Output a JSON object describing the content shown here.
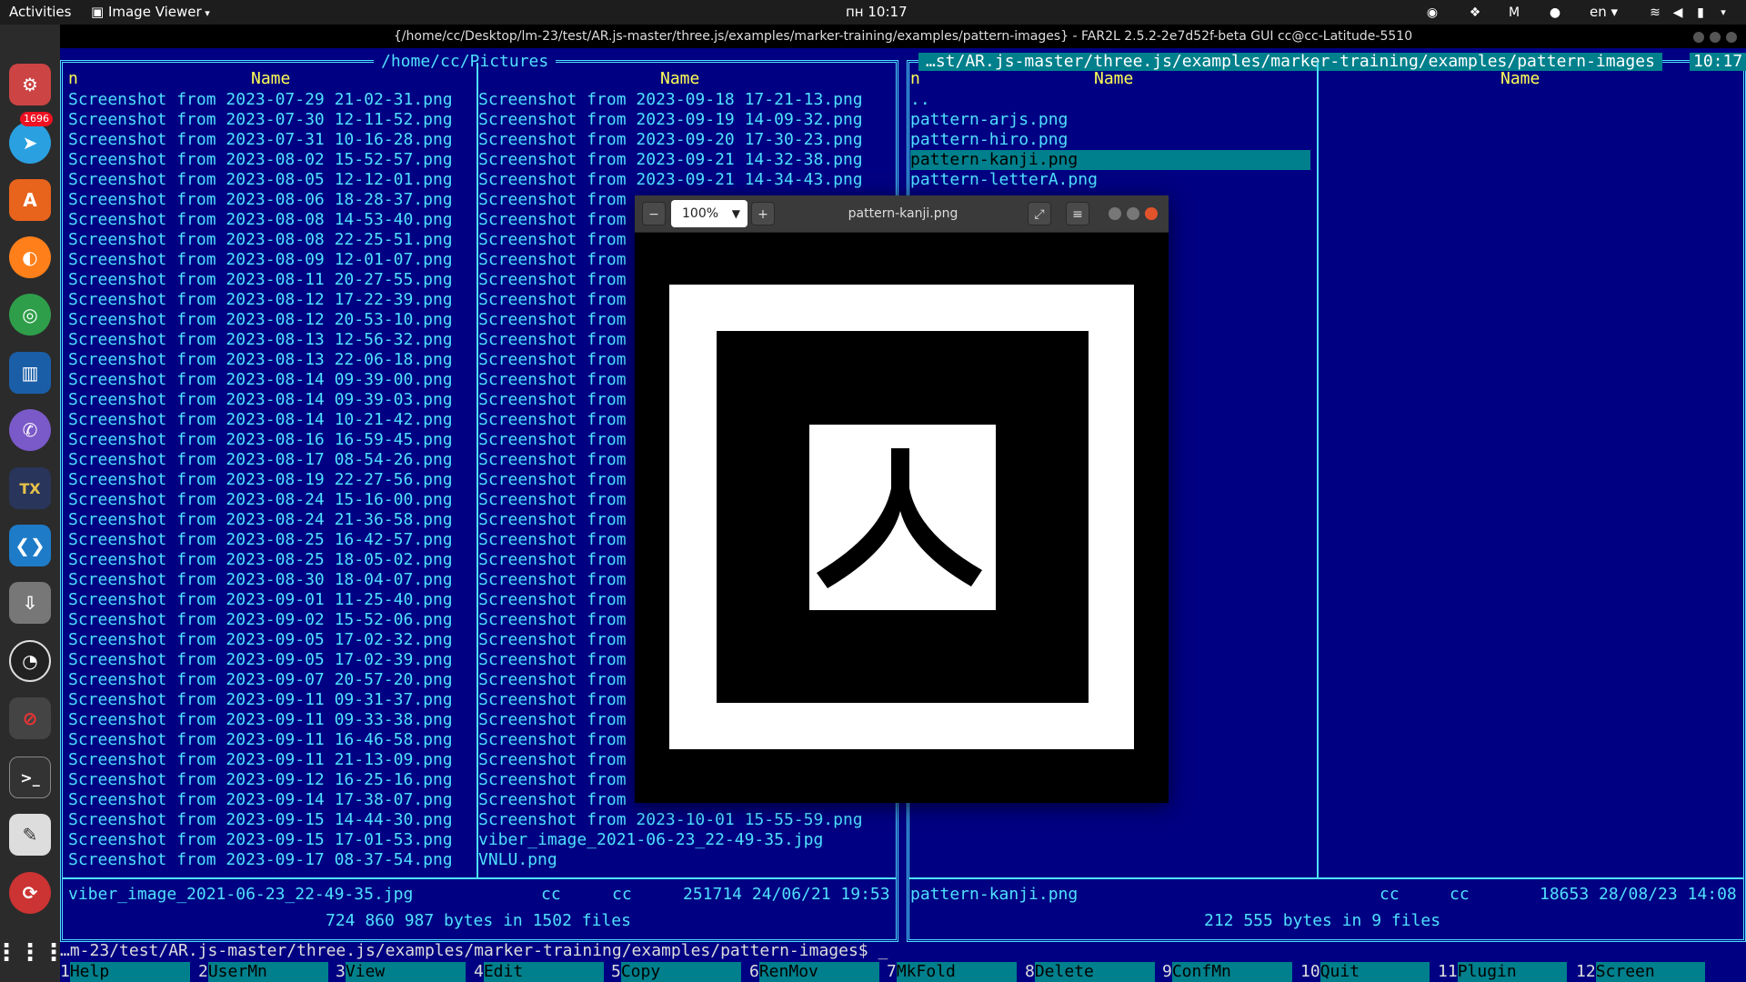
{
  "topbar": {
    "activities": "Activities",
    "app_menu": "Image Viewer",
    "clock": "пн 10:17",
    "lang": "en"
  },
  "dock": {
    "telegram_badge": "1696",
    "items": [
      "settings-icon",
      "telegram-icon",
      "software-center-icon",
      "firefox-icon",
      "chrome-icon",
      "file-manager-icon",
      "viber-icon",
      "texmaker-icon",
      "vscode-icon",
      "installer-icon",
      "obs-icon",
      "blocker-icon",
      "terminal-icon",
      "text-editor-icon",
      "remmina-icon",
      "app-grid-icon"
    ]
  },
  "terminal": {
    "window_title": "{/home/cc/Desktop/lm-23/test/AR.js-master/three.js/examples/marker-training/examples/pattern-images} - FAR2L 2.5.2-2e7d52f-beta GUI cc@cc-Latitude-5510",
    "left_panel": {
      "path": "/home/cc/Pictures",
      "col1_header_n": "n",
      "col1_header": "Name",
      "col2_header": "Name",
      "col1": [
        "Screenshot from 2023-07-29 21-02-31.png",
        "Screenshot from 2023-07-30 12-11-52.png",
        "Screenshot from 2023-07-31 10-16-28.png",
        "Screenshot from 2023-08-02 15-52-57.png",
        "Screenshot from 2023-08-05 12-12-01.png",
        "Screenshot from 2023-08-06 18-28-37.png",
        "Screenshot from 2023-08-08 14-53-40.png",
        "Screenshot from 2023-08-08 22-25-51.png",
        "Screenshot from 2023-08-09 12-01-07.png",
        "Screenshot from 2023-08-11 20-27-55.png",
        "Screenshot from 2023-08-12 17-22-39.png",
        "Screenshot from 2023-08-12 20-53-10.png",
        "Screenshot from 2023-08-13 12-56-32.png",
        "Screenshot from 2023-08-13 22-06-18.png",
        "Screenshot from 2023-08-14 09-39-00.png",
        "Screenshot from 2023-08-14 09-39-03.png",
        "Screenshot from 2023-08-14 10-21-42.png",
        "Screenshot from 2023-08-16 16-59-45.png",
        "Screenshot from 2023-08-17 08-54-26.png",
        "Screenshot from 2023-08-19 22-27-56.png",
        "Screenshot from 2023-08-24 15-16-00.png",
        "Screenshot from 2023-08-24 21-36-58.png",
        "Screenshot from 2023-08-25 16-42-57.png",
        "Screenshot from 2023-08-25 18-05-02.png",
        "Screenshot from 2023-08-30 18-04-07.png",
        "Screenshot from 2023-09-01 11-25-40.png",
        "Screenshot from 2023-09-02 15-52-06.png",
        "Screenshot from 2023-09-05 17-02-32.png",
        "Screenshot from 2023-09-05 17-02-39.png",
        "Screenshot from 2023-09-07 20-57-20.png",
        "Screenshot from 2023-09-11 09-31-37.png",
        "Screenshot from 2023-09-11 09-33-38.png",
        "Screenshot from 2023-09-11 16-46-58.png",
        "Screenshot from 2023-09-11 21-13-09.png",
        "Screenshot from 2023-09-12 16-25-16.png",
        "Screenshot from 2023-09-14 17-38-07.png",
        "Screenshot from 2023-09-15 14-44-30.png",
        "Screenshot from 2023-09-15 17-01-53.png",
        "Screenshot from 2023-09-17 08-37-54.png"
      ],
      "col2": [
        "Screenshot from 2023-09-18 17-21-13.png",
        "Screenshot from 2023-09-19 14-09-32.png",
        "Screenshot from 2023-09-20 17-30-23.png",
        "Screenshot from 2023-09-21 14-32-38.png",
        "Screenshot from 2023-09-21 14-34-43.png",
        "Screenshot from",
        "Screenshot from",
        "Screenshot from",
        "Screenshot from",
        "Screenshot from",
        "Screenshot from",
        "Screenshot from",
        "Screenshot from",
        "Screenshot from",
        "Screenshot from",
        "Screenshot from",
        "Screenshot from",
        "Screenshot from",
        "Screenshot from",
        "Screenshot from",
        "Screenshot from",
        "Screenshot from",
        "Screenshot from",
        "Screenshot from",
        "Screenshot from",
        "Screenshot from",
        "Screenshot from",
        "Screenshot from",
        "Screenshot from",
        "Screenshot from",
        "Screenshot from",
        "Screenshot from",
        "Screenshot from",
        "Screenshot from",
        "Screenshot from",
        "Screenshot from",
        "Screenshot from 2023-10-01 15-55-59.png",
        "viber_image_2021-06-23_22-49-35.jpg",
        "VNLU.png"
      ],
      "footer_name": "viber_image_2021-06-23_22-49-35.jpg",
      "footer_owner": "cc",
      "footer_group": "cc",
      "footer_size_date": "251714 24/06/21 19:53",
      "summary": "724 860 987 bytes in 1502 files"
    },
    "right_panel": {
      "path": "…st/AR.js-master/three.js/examples/marker-training/examples/pattern-images",
      "clock": "10:17",
      "col1_header_n": "n",
      "col1_header": "Name",
      "col2_header": "Name",
      "col1": [
        "..",
        "pattern-arjs.png",
        "pattern-hiro.png",
        "pattern-kanji.png",
        "pattern-letterA.png"
      ],
      "selected_index": 3,
      "footer_name": "pattern-kanji.png",
      "footer_owner": "cc",
      "footer_group": "cc",
      "footer_size_date": "18653 28/08/23 14:08",
      "summary": "212 555 bytes in 9 files"
    },
    "command_line": "…m-23/test/AR.js-master/three.js/examples/marker-training/examples/pattern-images$ _",
    "keybar": [
      {
        "n": "1",
        "label": "Help"
      },
      {
        "n": "2",
        "label": "UserMn"
      },
      {
        "n": "3",
        "label": "View"
      },
      {
        "n": "4",
        "label": "Edit"
      },
      {
        "n": "5",
        "label": "Copy"
      },
      {
        "n": "6",
        "label": "RenMov"
      },
      {
        "n": "7",
        "label": "MkFold"
      },
      {
        "n": "8",
        "label": "Delete"
      },
      {
        "n": "9",
        "label": "ConfMn"
      },
      {
        "n": "10",
        "label": "Quit"
      },
      {
        "n": "11",
        "label": "Plugin"
      },
      {
        "n": "12",
        "label": "Screen"
      }
    ]
  },
  "viewer": {
    "title": "pattern-kanji.png",
    "zoom": "100%",
    "kanji": "人"
  },
  "colors": {
    "far_bg": "#000082",
    "far_text": "#4fe0ff",
    "far_header": "#ffff55",
    "far_select": "#00808c"
  }
}
